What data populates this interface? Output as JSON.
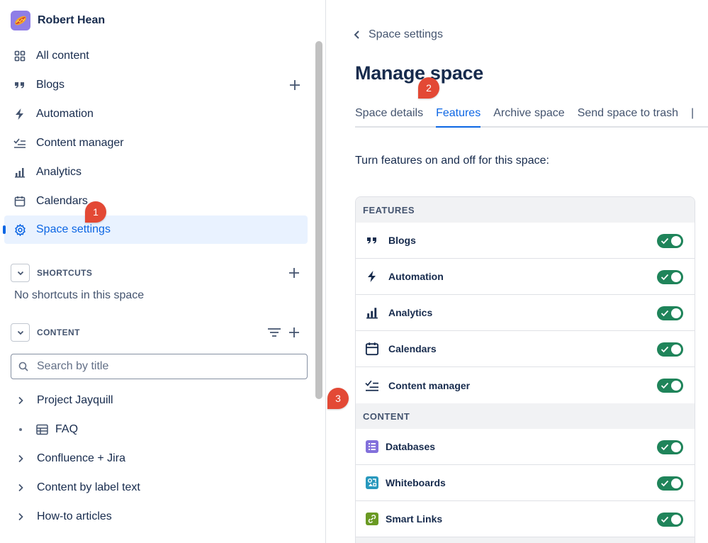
{
  "space": {
    "name": "Robert Hean"
  },
  "nav": [
    {
      "label": "All content",
      "icon": "grid-icon"
    },
    {
      "label": "Blogs",
      "icon": "quote-icon"
    },
    {
      "label": "Automation",
      "icon": "lightning-icon"
    },
    {
      "label": "Content manager",
      "icon": "checklist-icon"
    },
    {
      "label": "Analytics",
      "icon": "bar-chart-icon"
    },
    {
      "label": "Calendars",
      "icon": "calendar-icon"
    },
    {
      "label": "Space settings",
      "icon": "gear-icon",
      "active": true
    }
  ],
  "shortcuts": {
    "title": "SHORTCUTS",
    "empty": "No shortcuts in this space"
  },
  "content": {
    "title": "CONTENT"
  },
  "search": {
    "placeholder": "Search by title"
  },
  "tree": [
    {
      "label": "Project Jayquill",
      "type": "expandable"
    },
    {
      "label": "FAQ",
      "type": "database"
    },
    {
      "label": "Confluence + Jira",
      "type": "expandable"
    },
    {
      "label": "Content by label text",
      "type": "expandable"
    },
    {
      "label": "How-to articles",
      "type": "expandable"
    }
  ],
  "main": {
    "back_label": "Space settings",
    "title": "Manage space",
    "tabs": [
      "Space details",
      "Features",
      "Archive space",
      "Send space to trash"
    ],
    "active_tab": "Features",
    "intro": "Turn features on and off for this space:"
  },
  "features_panel": {
    "header": "FEATURES",
    "features": [
      {
        "label": "Blogs",
        "icon": "quote-icon",
        "enabled": true
      },
      {
        "label": "Automation",
        "icon": "lightning-icon",
        "enabled": true
      },
      {
        "label": "Analytics",
        "icon": "bar-chart-icon",
        "enabled": true
      },
      {
        "label": "Calendars",
        "icon": "calendar-icon",
        "enabled": true
      },
      {
        "label": "Content manager",
        "icon": "checklist-icon",
        "enabled": true
      }
    ],
    "content_header": "CONTENT",
    "content_types": [
      {
        "label": "Databases",
        "icon": "database-icon",
        "color": "#8270db",
        "enabled": true
      },
      {
        "label": "Whiteboards",
        "icon": "whiteboard-icon",
        "color": "#2898bd",
        "enabled": true
      },
      {
        "label": "Smart Links",
        "icon": "link-icon",
        "color": "#6a9a23",
        "enabled": true
      }
    ]
  },
  "markers": [
    "1",
    "2",
    "3"
  ],
  "colors": {
    "accent": "#0c66e4",
    "toggle_on": "#1f845a",
    "marker": "#e34935"
  }
}
